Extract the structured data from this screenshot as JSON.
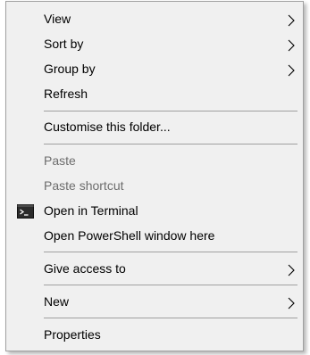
{
  "menu": {
    "view_label": "View",
    "sort_by_label": "Sort by",
    "group_by_label": "Group by",
    "refresh_label": "Refresh",
    "customise_label": "Customise this folder...",
    "paste_label": "Paste",
    "paste_shortcut_label": "Paste shortcut",
    "open_terminal_label": "Open in Terminal",
    "open_powershell_label": "Open PowerShell window here",
    "give_access_label": "Give access to",
    "new_label": "New",
    "properties_label": "Properties"
  },
  "icons": {
    "submenu": "chevron-right-icon",
    "terminal": "terminal-icon"
  },
  "colors": {
    "menu_background": "#f0f0f0",
    "separator": "#a0a0a0",
    "disabled_text": "#6d6d6d"
  }
}
